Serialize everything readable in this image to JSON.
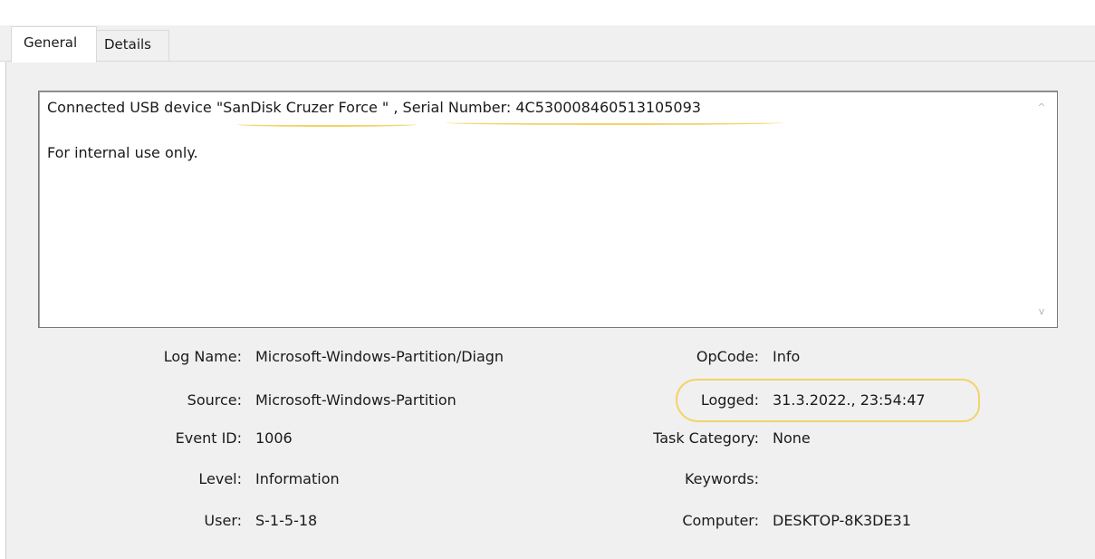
{
  "tabs": [
    {
      "label": "General"
    },
    {
      "label": "Details"
    }
  ],
  "description": {
    "line1_prefix": "Connected USB device ",
    "device_name": "\"SanDisk Cruzer Force \"",
    "line1_sep": " , ",
    "serial": "Serial Number: 4C530008460513105093",
    "line2": "For internal use only."
  },
  "scrollbar": {
    "up_glyph": "^",
    "down_glyph": "v"
  },
  "fields_left": [
    {
      "label": "Log Name:",
      "value": "Microsoft-Windows-Partition/Diagn"
    },
    {
      "label": "Source:",
      "value": "Microsoft-Windows-Partition"
    },
    {
      "label": "Event ID:",
      "value": "1006"
    },
    {
      "label": "Level:",
      "value": "Information"
    },
    {
      "label": "User:",
      "value": "S-1-5-18"
    }
  ],
  "fields_right": [
    {
      "label": "OpCode:",
      "value": "Info"
    },
    {
      "label": "Logged:",
      "value": "31.3.2022., 23:54:47"
    },
    {
      "label": "Task Category:",
      "value": "None"
    },
    {
      "label": "Keywords:",
      "value": ""
    },
    {
      "label": "Computer:",
      "value": "DESKTOP-8K3DE31"
    }
  ],
  "annotation_color": "#f2d36a"
}
